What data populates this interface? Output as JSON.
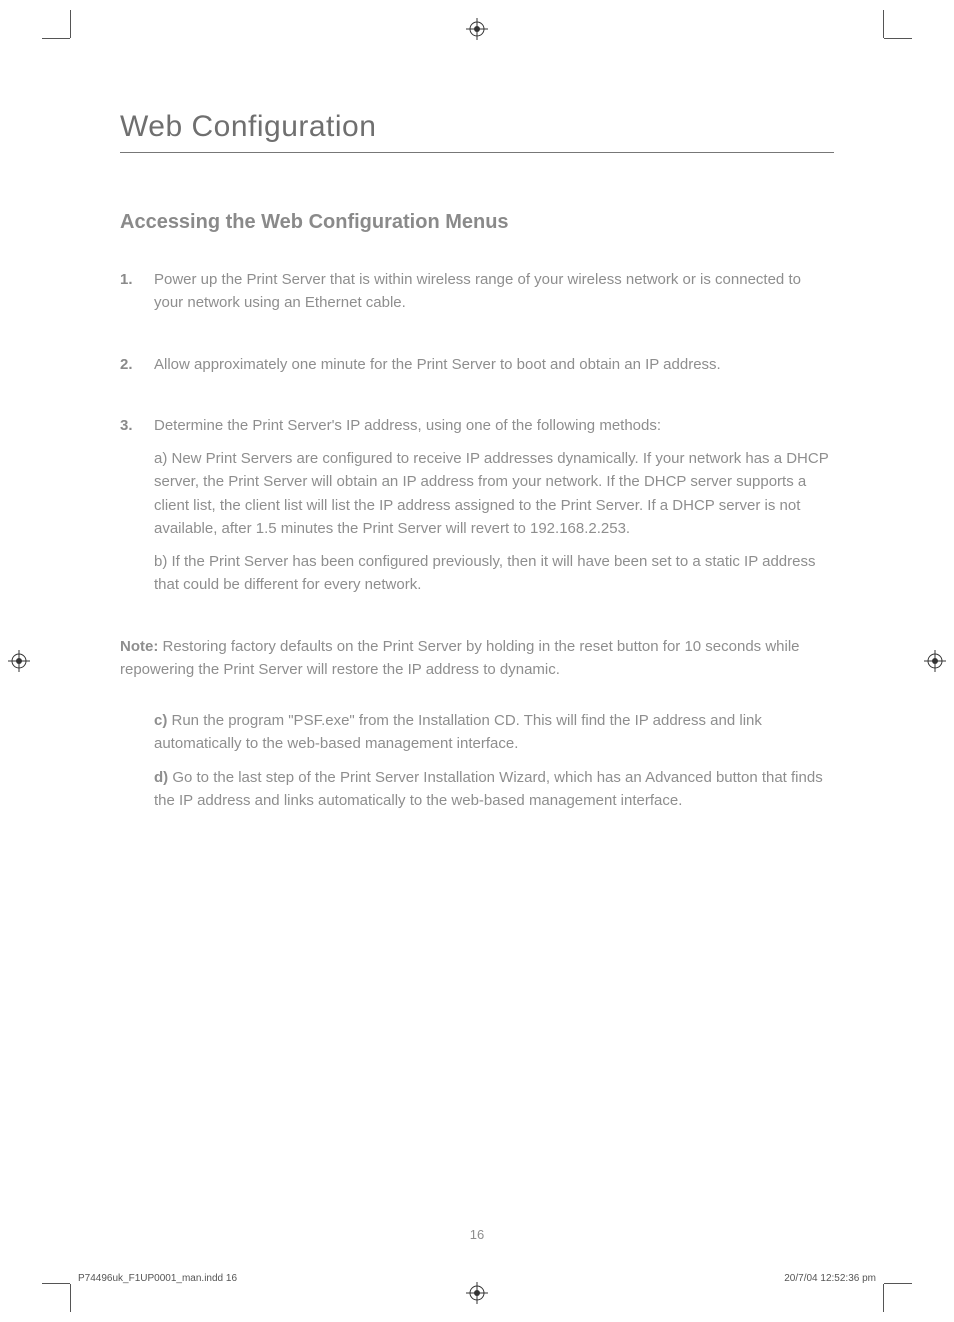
{
  "title": "Web Configuration",
  "subtitle": "Accessing the Web Configuration Menus",
  "steps": [
    {
      "num": "1.",
      "paras": [
        "Power up the Print Server that is within wireless range of your wireless network or is connected to your network using an Ethernet cable."
      ]
    },
    {
      "num": "2.",
      "paras": [
        "Allow approximately one minute for the Print Server to boot and obtain an IP address."
      ]
    },
    {
      "num": "3.",
      "paras": [
        "Determine the Print Server's IP address, using one of the following methods:",
        "a) New Print Servers are configured to receive IP addresses dynamically. If your network has a DHCP server, the Print Server will obtain an IP address from your network. If the DHCP server supports a client list, the client list will list the IP address assigned to the Print Server. If a DHCP server is not available, after 1.5 minutes the Print Server will revert to 192.168.2.253.",
        "b) If the Print Server has been configured previously, then it will have been set to a static IP address that could be different for every network."
      ]
    }
  ],
  "note_label": "Note:",
  "note_text": " Restoring factory defaults on the Print Server by holding in the reset button for 10 seconds while repowering the Print Server will restore the IP address to dynamic.",
  "subitems": [
    {
      "letter": "c)",
      "text": " Run the program \"PSF.exe\" from the Installation CD. This will find the IP address and link automatically to the web-based management interface."
    },
    {
      "letter": "d)",
      "text": " Go to the last step of the Print Server Installation Wizard, which has an Advanced button that finds the IP address and links automatically to the web-based management interface."
    }
  ],
  "page_number": "16",
  "footer_left": "P74496uk_F1UP0001_man.indd   16",
  "footer_right": "20/7/04   12:52:36 pm"
}
